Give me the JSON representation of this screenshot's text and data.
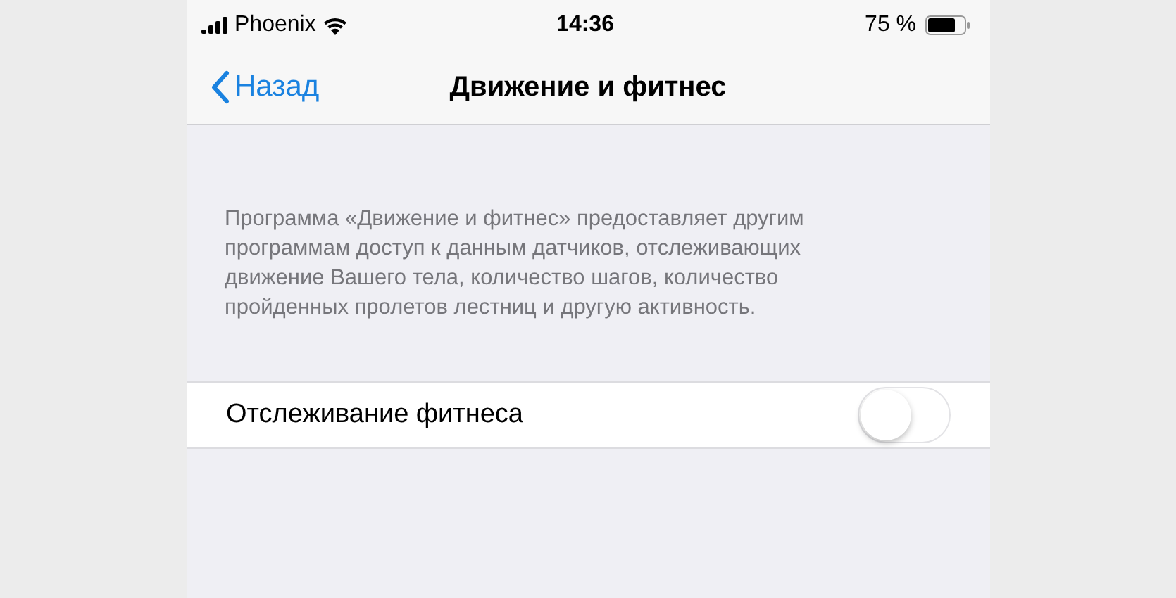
{
  "status_bar": {
    "carrier": "Phoenix",
    "time": "14:36",
    "battery": "75 %"
  },
  "nav_bar": {
    "back": "Назад",
    "title": "Движение и фитнес"
  },
  "description": "Программа «Движение и фитнес» предоставляет другим программам доступ к данным датчиков, отслеживающих движение Вашего тела, количество шагов, количество пройденных пролетов лестниц и другую активность.",
  "settings": [
    {
      "label": "Отслеживание фитнеса",
      "on": false
    }
  ]
}
